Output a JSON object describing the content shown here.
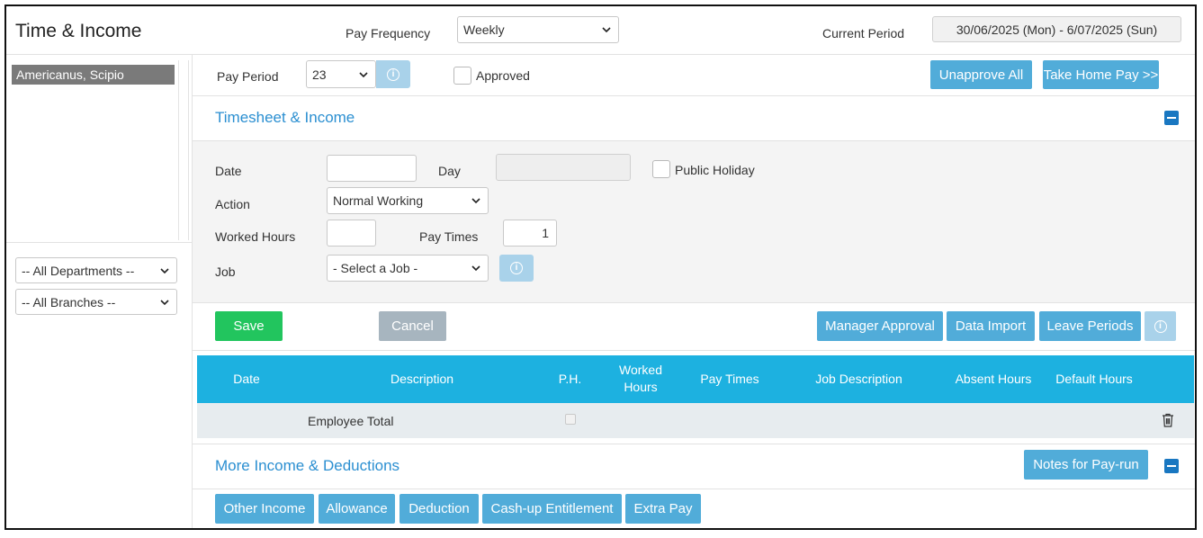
{
  "header": {
    "title": "Time & Income",
    "pay_frequency_label": "Pay Frequency",
    "pay_frequency_value": "Weekly",
    "current_period_label": "Current Period",
    "current_period_value": "30/06/2025 (Mon) - 6/07/2025 (Sun)"
  },
  "sidebar": {
    "employees": [
      "Americanus, Scipio"
    ],
    "departments_filter": "-- All Departments --",
    "branches_filter": "-- All Branches --"
  },
  "period_bar": {
    "pay_period_label": "Pay Period",
    "pay_period_value": "23",
    "approved_label": "Approved",
    "unapprove_all": "Unapprove All",
    "take_home_pay": "Take Home Pay >>"
  },
  "timesheet": {
    "title": "Timesheet & Income",
    "date_label": "Date",
    "date_value": "",
    "day_label": "Day",
    "day_value": "",
    "public_holiday_label": "Public Holiday",
    "action_label": "Action",
    "action_value": "Normal Working",
    "worked_hours_label": "Worked Hours",
    "worked_hours_value": "",
    "pay_times_label": "Pay Times",
    "pay_times_value": "1",
    "job_label": "Job",
    "job_value": "- Select a Job -"
  },
  "actions": {
    "save": "Save",
    "cancel": "Cancel",
    "manager_approval": "Manager Approval",
    "data_import": "Data Import",
    "leave_periods": "Leave Periods"
  },
  "table": {
    "columns": [
      "Date",
      "Description",
      "P.H.",
      "Worked Hours",
      "Pay Times",
      "Job Description",
      "Absent Hours",
      "Default Hours"
    ],
    "total_row_label": "Employee Total"
  },
  "more_income": {
    "title": "More Income & Deductions",
    "notes_button": "Notes for Pay-run",
    "buttons": [
      "Other Income",
      "Allowance",
      "Deduction",
      "Cash-up Entitlement",
      "Extra Pay"
    ]
  },
  "colors": {
    "accent_blue": "#51acd9",
    "table_header": "#1db1e0",
    "save_green": "#22c55e",
    "section_title": "#2b8fd1",
    "collapse_icon": "#1977c1",
    "selected_employee": "#7a7a7a"
  }
}
